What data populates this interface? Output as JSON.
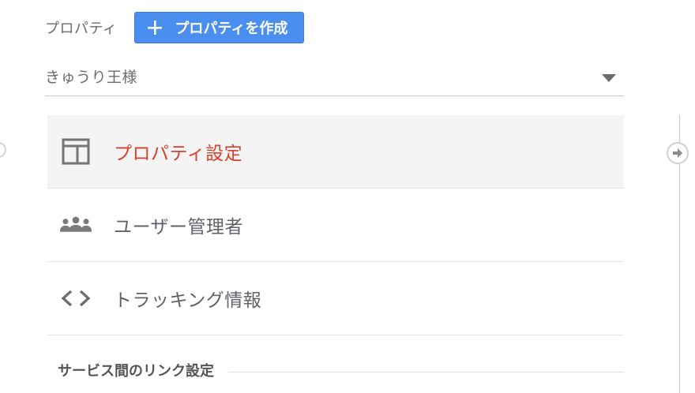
{
  "header": {
    "label": "プロパティ",
    "create_button_label": "プロパティを作成"
  },
  "property_select": {
    "value": "きゅうり王様"
  },
  "menu": {
    "items": [
      {
        "label": "プロパティ設定",
        "icon": "layout-icon",
        "active": true
      },
      {
        "label": "ユーザー管理者",
        "icon": "users-icon",
        "active": false
      },
      {
        "label": "トラッキング情報",
        "icon": "code-icon",
        "active": false
      }
    ]
  },
  "section": {
    "heading": "サービス間のリンク設定"
  },
  "colors": {
    "accent_button": "#4a8ef0",
    "active_text": "#d9412e",
    "active_background": "#f4f4f4"
  }
}
